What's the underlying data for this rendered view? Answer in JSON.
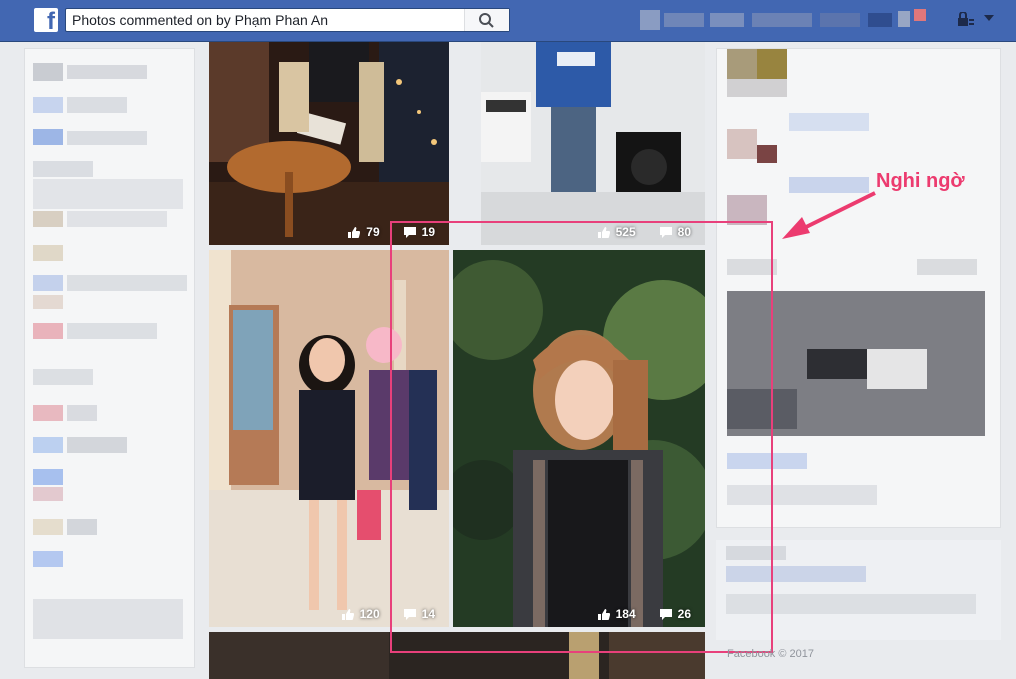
{
  "header": {
    "logo_letter": "f",
    "search_value": "Photos commented on by Phạm Phan An",
    "search_icon": "search-icon",
    "lock_icon": "lock-icon",
    "menu_icon": "caret-down-icon",
    "brand_color": "#4267b2"
  },
  "photos": [
    {
      "id": "p1",
      "likes": "79",
      "comments": "19"
    },
    {
      "id": "p2",
      "likes": "525",
      "comments": "80"
    },
    {
      "id": "p3",
      "likes": "120",
      "comments": "14"
    },
    {
      "id": "p4",
      "likes": "184",
      "comments": "26"
    }
  ],
  "annotation": {
    "label": "Nghi ngờ",
    "color": "#ec3b6f"
  },
  "footer": {
    "copyright": "Facebook © 2017"
  }
}
